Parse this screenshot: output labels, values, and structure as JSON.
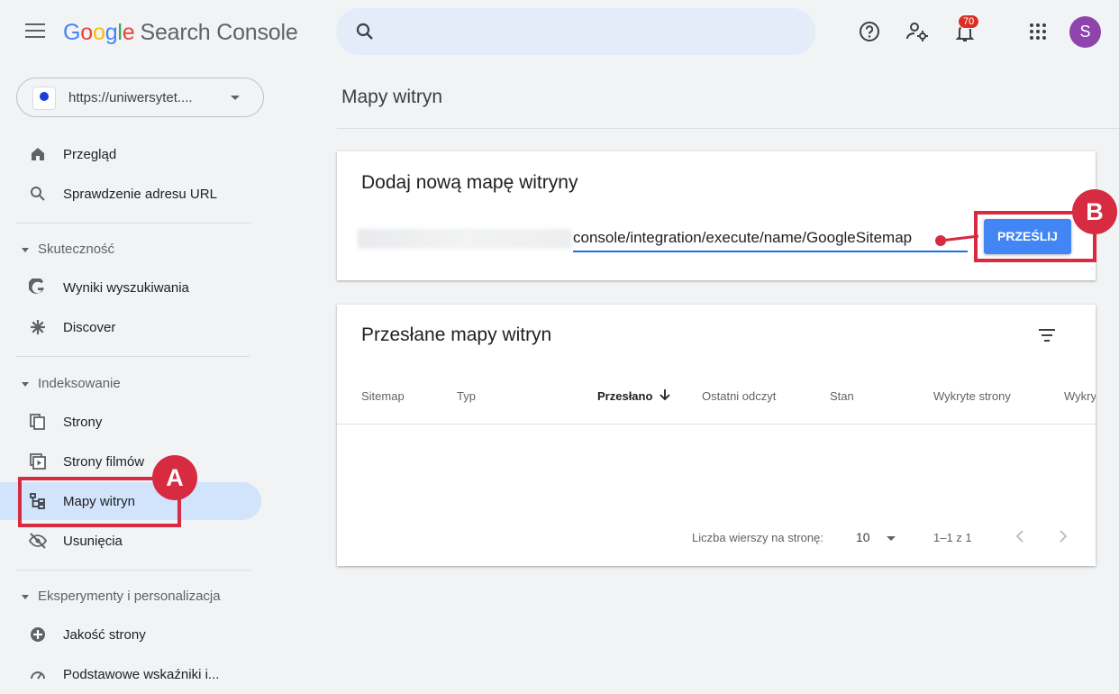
{
  "app": {
    "name_parts": [
      "G",
      "o",
      "o",
      "g",
      "l",
      "e"
    ],
    "product": "Search Console"
  },
  "header": {
    "notifications_count": "70",
    "avatar_letter": "S"
  },
  "property": {
    "url": "https://uniwersytet...."
  },
  "sidebar": {
    "items": [
      {
        "label": "Przegląd",
        "icon": "home-icon"
      },
      {
        "label": "Sprawdzenie adresu URL",
        "icon": "search-icon"
      }
    ],
    "sections": [
      {
        "label": "Skuteczność",
        "items": [
          {
            "label": "Wyniki wyszukiwania",
            "icon": "google-g-icon"
          },
          {
            "label": "Discover",
            "icon": "asterisk-icon"
          }
        ]
      },
      {
        "label": "Indeksowanie",
        "items": [
          {
            "label": "Strony",
            "icon": "pages-icon"
          },
          {
            "label": "Strony filmów",
            "icon": "video-pages-icon"
          },
          {
            "label": "Mapy witryn",
            "icon": "sitemap-icon",
            "active": true
          },
          {
            "label": "Usunięcia",
            "icon": "eye-off-icon"
          }
        ]
      },
      {
        "label": "Eksperymenty i personalizacja",
        "items": [
          {
            "label": "Jakość strony",
            "icon": "plus-circle-icon"
          },
          {
            "label": "Podstawowe wskaźniki i...",
            "icon": "gauge-icon"
          }
        ]
      }
    ]
  },
  "main": {
    "page_title": "Mapy witryn",
    "add_card": {
      "title": "Dodaj nową mapę witryny",
      "input_value": "console/integration/execute/name/GoogleSitemap",
      "submit_label": "PRZEŚLIJ"
    },
    "list_card": {
      "title": "Przesłane mapy witryn",
      "columns": [
        "Sitemap",
        "Typ",
        "Przesłano",
        "Ostatni odczyt",
        "Stan",
        "Wykryte strony",
        "Wykry"
      ],
      "rows_per_page_label": "Liczba wierszy na stronę:",
      "rows_per_page_value": "10",
      "range": "1–1 z 1"
    }
  },
  "annotations": {
    "a": "A",
    "b": "B",
    "color": "#d62b40"
  }
}
